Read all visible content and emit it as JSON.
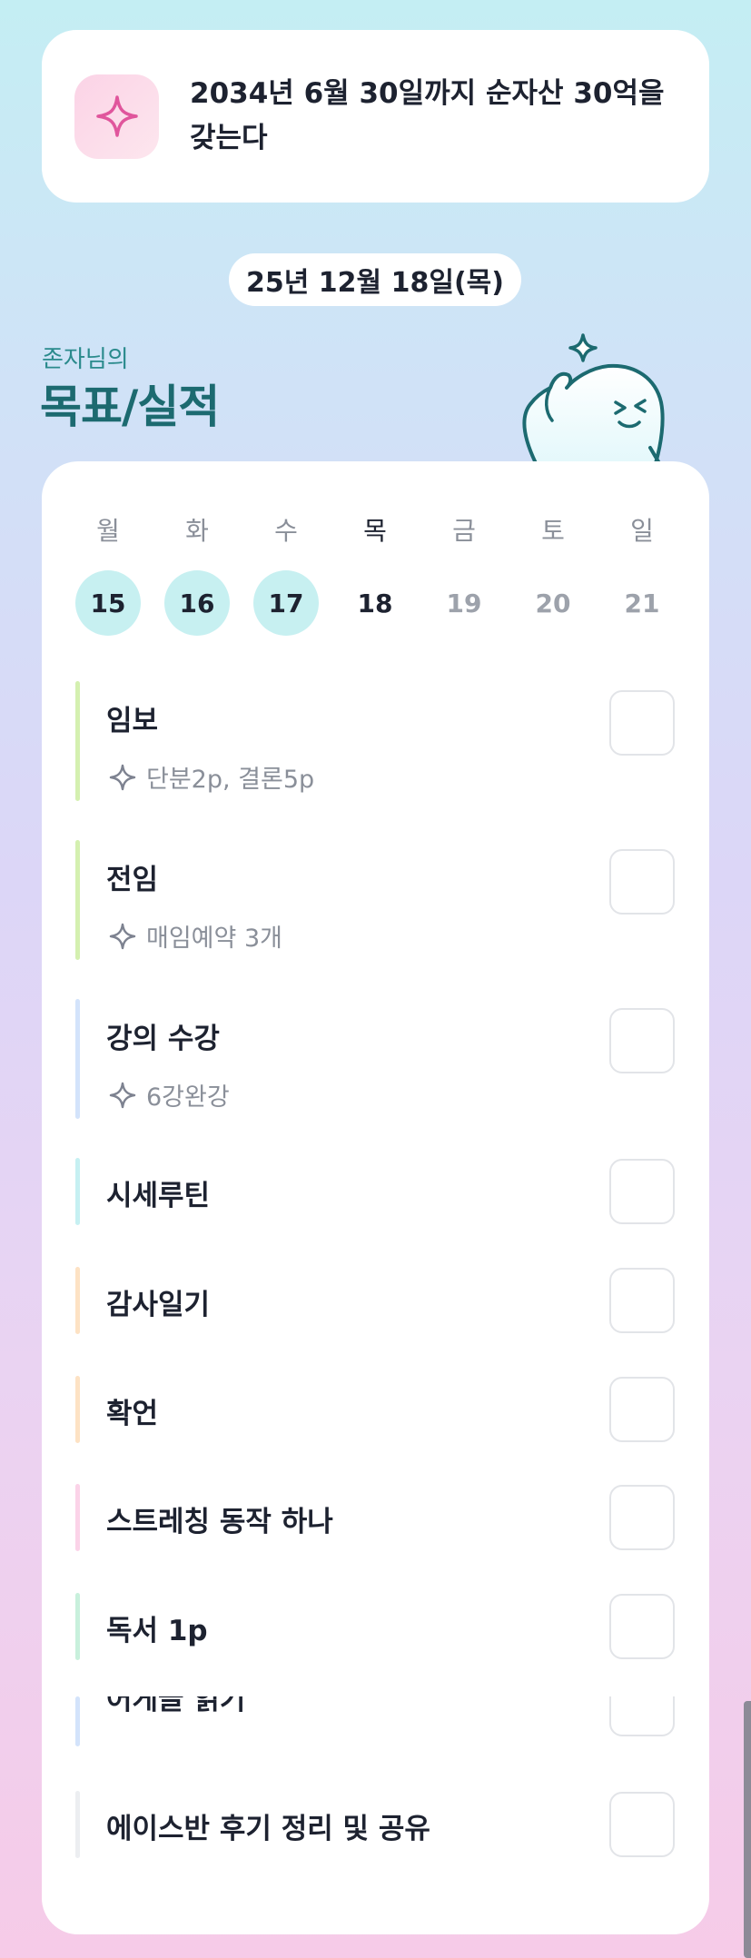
{
  "goal": {
    "line1": "2034년 6월 30일까지 순자산 30억을",
    "line2": "갖는다",
    "icon": "sparkle-icon"
  },
  "date_label": "25년 12월 18일(목)",
  "owner_label": "존자님의",
  "section_title": "목표/실적",
  "week": {
    "days": [
      {
        "label": "월",
        "num": "15",
        "state": "done"
      },
      {
        "label": "화",
        "num": "16",
        "state": "done"
      },
      {
        "label": "수",
        "num": "17",
        "state": "done"
      },
      {
        "label": "목",
        "num": "18",
        "state": "today"
      },
      {
        "label": "금",
        "num": "19",
        "state": "future"
      },
      {
        "label": "토",
        "num": "20",
        "state": "future"
      },
      {
        "label": "일",
        "num": "21",
        "state": "future"
      }
    ]
  },
  "tasks": [
    {
      "title": "임보",
      "sub": "단분2p, 결론5p",
      "color": "#d4f0b0",
      "checked": false
    },
    {
      "title": "전임",
      "sub": "매임예약 3개",
      "color": "#d4f0b0",
      "checked": false
    },
    {
      "title": "강의 수강",
      "sub": "6강완강",
      "color": "#d3e3fb",
      "checked": false
    },
    {
      "title": "시세루틴",
      "color": "#c6f0f2",
      "checked": false
    },
    {
      "title": "감사일기",
      "color": "#fde2c4",
      "checked": false
    },
    {
      "title": "확언",
      "color": "#fde2c4",
      "checked": false
    },
    {
      "title": "스트레칭 동작 하나",
      "color": "#fbd3e8",
      "checked": false
    },
    {
      "title": "독서 1p",
      "color": "#c8f0dc",
      "checked": false
    },
    {
      "title": "어게글 읽기",
      "color": "#d3e3fb",
      "checked": false
    },
    {
      "title": "에이스반 후기 정리 및 공유",
      "color": "#eceef1",
      "checked": false
    }
  ]
}
